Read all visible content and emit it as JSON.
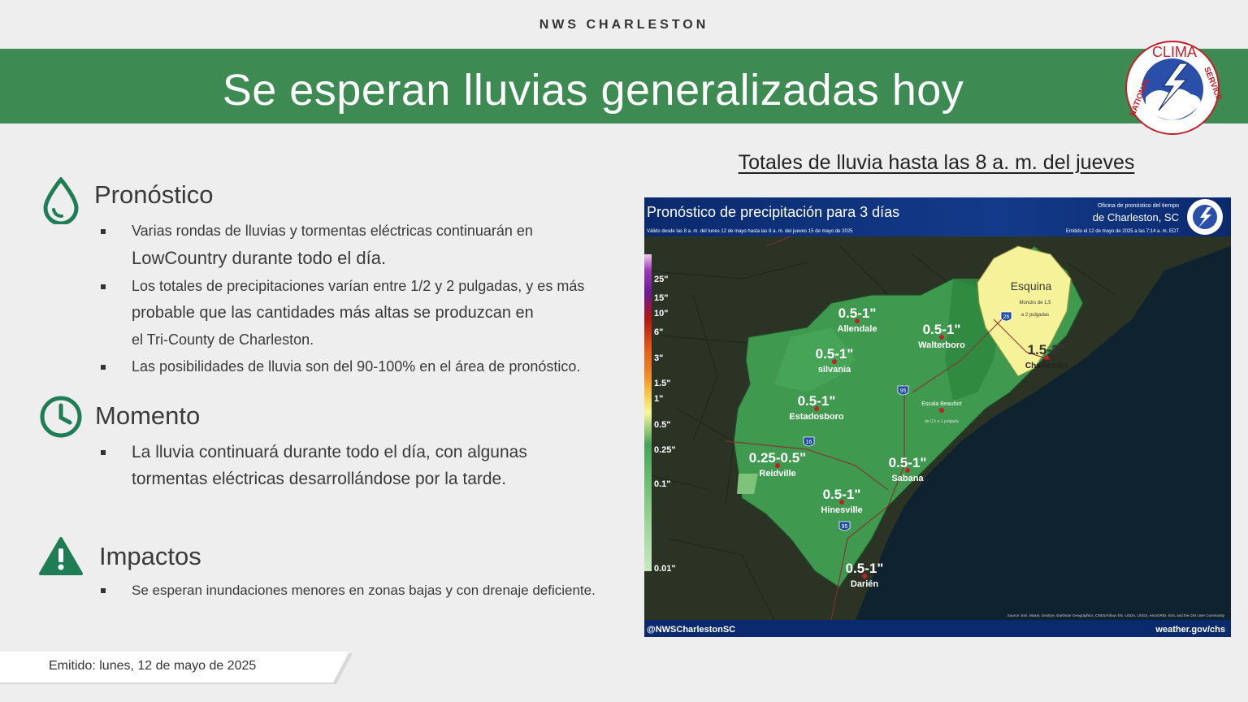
{
  "header": {
    "office": "NWS CHARLESTON",
    "title": "Se esperan lluvias generalizadas hoy",
    "logo_text_top": "CLIMA",
    "logo_text_left": "NATIONAL",
    "logo_text_right": "SERVICE"
  },
  "sections": {
    "forecast": {
      "title": "Pronóstico",
      "icon": "water-drop-icon",
      "bullets": [
        [
          "Varias rondas de lluvias y tormentas eléctricas continuarán en",
          "LowCountry durante todo el día."
        ],
        [
          "Los totales de precipitaciones varían entre 1/2 y 2 pulgadas, y es más",
          "probable que las cantidades más altas se produzcan en",
          "el Tri-County de Charleston."
        ],
        [
          "Las posibilidades de lluvia son del 90-100% en el área de pronóstico."
        ]
      ]
    },
    "timing": {
      "title": "Momento",
      "icon": "clock-icon",
      "bullets": [
        [
          "La lluvia continuará durante todo el día, con algunas",
          "tormentas eléctricas desarrollándose por la tarde."
        ]
      ]
    },
    "impacts": {
      "title": "Impactos",
      "icon": "warning-icon",
      "bullets": [
        [
          "Se esperan inundaciones menores en zonas bajas y con drenaje deficiente."
        ]
      ]
    }
  },
  "map": {
    "heading": "Totales de lluvia hasta las 8 a. m. del jueves",
    "title": "Pronóstico de precipitación para 3 días",
    "valid": "Válido desde las 8 a. m. del lunes 12 de mayo hasta las 8 a. m. del jueves 15 de mayo de 2025",
    "office_line1": "Oficina de pronóstico del tiempo",
    "office_line2": "de Charleston, SC",
    "issued": "Emitido el 12 de mayo de 2025 a las 7:14 a. m. EDT",
    "handle": "@NWSCharlestonSC",
    "url": "weather.gov/chs",
    "source": "Source: Esri, Maxar, GeoEye, Earthstar Geographics, CNES/Airbus DS, USDA, USGS, AeroGRID, IGN, and the GIS User Community",
    "legend": [
      "25\"",
      "15\"",
      "10\"",
      "6\"",
      "3\"",
      "1.5\"",
      "1\"",
      "0.5\"",
      "0.25\"",
      "0.1\"",
      "0.01\""
    ],
    "legend_colors": [
      "#f2c8f2",
      "#9b3bb5",
      "#6a1a9a",
      "#b21515",
      "#e65a1a",
      "#f08a25",
      "#f5c846",
      "#f7f79a",
      "#46a35a",
      "#6dbe72",
      "#9ed49a",
      "#c9e8c0"
    ],
    "labels": [
      {
        "amount": "0.5-1\"",
        "place": "Allendale"
      },
      {
        "amount": "0.5-1\"",
        "place": "Walterboro"
      },
      {
        "amount": "0.5-1\"",
        "place": "silvania"
      },
      {
        "amount": "0.5-1\"",
        "place": "Estadosboro"
      },
      {
        "amount": "0.25-0.5\"",
        "place": "Reidville"
      },
      {
        "amount": "0.5-1\"",
        "place": "Sabana"
      },
      {
        "amount": "0.5-1\"",
        "place": "Hinesville"
      },
      {
        "amount": "0.5-1\"",
        "place": "Darién"
      },
      {
        "amount": "1.5-2\"",
        "place": "Charlestón"
      }
    ],
    "corner_label": "Esquina",
    "corner_note_1": "Moncks de 1,5",
    "corner_note_2": "a 2 pulgadas",
    "beaufort": "Escala Beaufort",
    "beaufort_note": "de 0,5 a 1 pulgada",
    "shields": [
      "26",
      "95",
      "16",
      "95"
    ]
  },
  "footer": {
    "issued": "Emitido: lunes, 12 de mayo de 2025"
  }
}
